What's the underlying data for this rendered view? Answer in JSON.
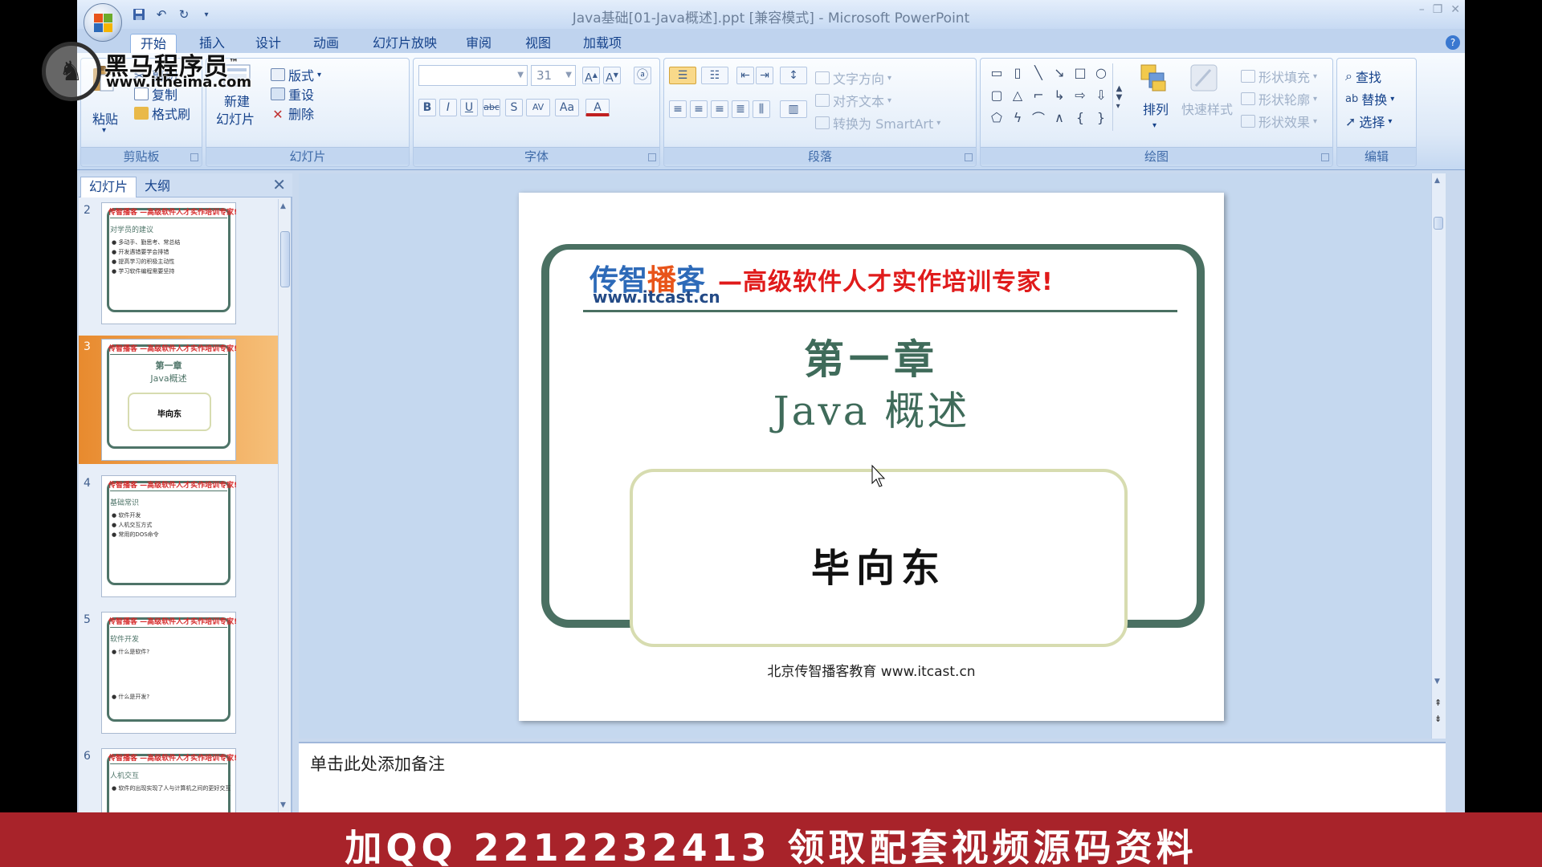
{
  "window": {
    "title": "Java基础[01-Java概述].ppt [兼容模式] - Microsoft PowerPoint"
  },
  "tabs": [
    "开始",
    "插入",
    "设计",
    "动画",
    "幻灯片放映",
    "审阅",
    "视图",
    "加载项"
  ],
  "ribbon": {
    "clipboard": {
      "label": "剪贴板",
      "paste": "粘贴",
      "cut": "剪切",
      "copy": "复制",
      "format_painter": "格式刷"
    },
    "slides": {
      "label": "幻灯片",
      "new_slide_line1": "新建",
      "new_slide_line2": "幻灯片",
      "layout": "版式",
      "reset": "重设",
      "delete": "删除"
    },
    "font": {
      "label": "字体",
      "font_name": "",
      "font_size": "31"
    },
    "paragraph": {
      "label": "段落",
      "text_direction": "文字方向",
      "align_text": "对齐文本",
      "convert_smartart": "转换为 SmartArt"
    },
    "drawing": {
      "label": "绘图",
      "arrange": "排列",
      "quick_styles": "快速样式",
      "shape_fill": "形状填充",
      "shape_outline": "形状轮廓",
      "shape_effects": "形状效果"
    },
    "editing": {
      "label": "编辑",
      "find": "查找",
      "replace": "替换",
      "select": "选择"
    }
  },
  "watermark": {
    "name": "黑马程序员",
    "tm": "™",
    "url": "www.itheima.com"
  },
  "left_pane": {
    "tab_slides": "幻灯片",
    "tab_outline": "大纲",
    "thumbnails": [
      {
        "num": "2",
        "header": "传智播客 —高级软件人才实作培训专家!",
        "title": "对学员的建议",
        "bullets": [
          "● 多动手、勤思考、常总结",
          "● 开发遇错要学会排错",
          "● 提高学习的积极主动性",
          "● 学习软件编程需要坚持"
        ]
      },
      {
        "num": "3",
        "header": "传智播客 —高级软件人才实作培训专家!",
        "title": "第一章",
        "subtitle": "Java概述",
        "author": "毕向东"
      },
      {
        "num": "4",
        "header": "传智播客 —高级软件人才实作培训专家!",
        "title": "基础常识",
        "bullets": [
          "● 软件开发",
          "● 人机交互方式",
          "● 常用的DOS命令"
        ]
      },
      {
        "num": "5",
        "header": "传智播客 —高级软件人才实作培训专家!",
        "title": "软件开发",
        "bullets": [
          "● 什么是软件?",
          "● 什么是开发?"
        ]
      },
      {
        "num": "6",
        "header": "传智播客 —高级软件人才实作培训专家!",
        "title": "人机交互",
        "bullets": [
          "● 软件的出现实现了人与计算机之间的更好交互"
        ]
      }
    ]
  },
  "slide": {
    "brand_a": "传智",
    "brand_b": "播",
    "brand_c": "客",
    "brand_url": "www.itcast.cn",
    "slogan": "—高级软件人才实作培训专家!",
    "chapter": "第一章",
    "subject": "Java 概述",
    "author": "毕向东",
    "footer": "北京传智播客教育   www.itcast.cn"
  },
  "notes": {
    "placeholder": "单击此处添加备注"
  },
  "banner": {
    "text": "加QQ 2212232413  领取配套视频源码资料"
  }
}
